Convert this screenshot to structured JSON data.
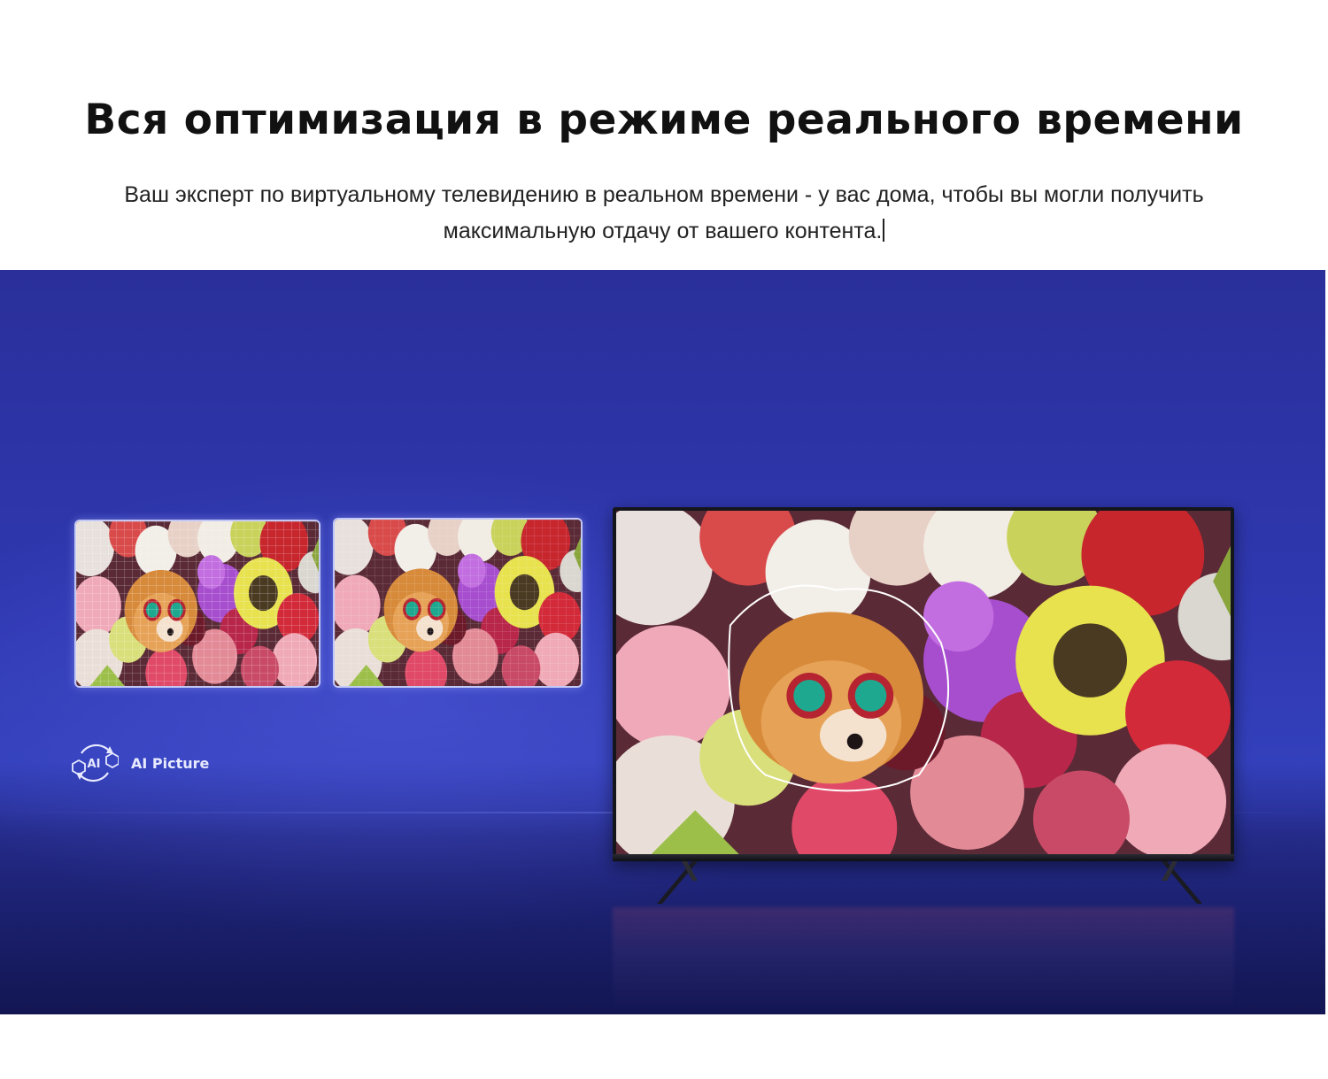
{
  "header": {
    "title": "Вся оптимизация в режиме реального времени",
    "subtitle": "Ваш эксперт по виртуальному телевидению в реальном времени - у вас дома, чтобы вы могли получить максимальную отдачу от вашего контента."
  },
  "hero": {
    "background_color": "#2f38b0",
    "thumbnails": [
      {
        "icon": "dog-flowers-low-res-image"
      },
      {
        "icon": "dog-flowers-processing-image"
      }
    ],
    "badge": {
      "icon": "ai-cube-cycle-icon",
      "icon_text": "AI",
      "label": "AI Picture"
    },
    "tv": {
      "icon": "tv-display",
      "screen_image": "dog-with-goggles-in-flowers"
    }
  }
}
